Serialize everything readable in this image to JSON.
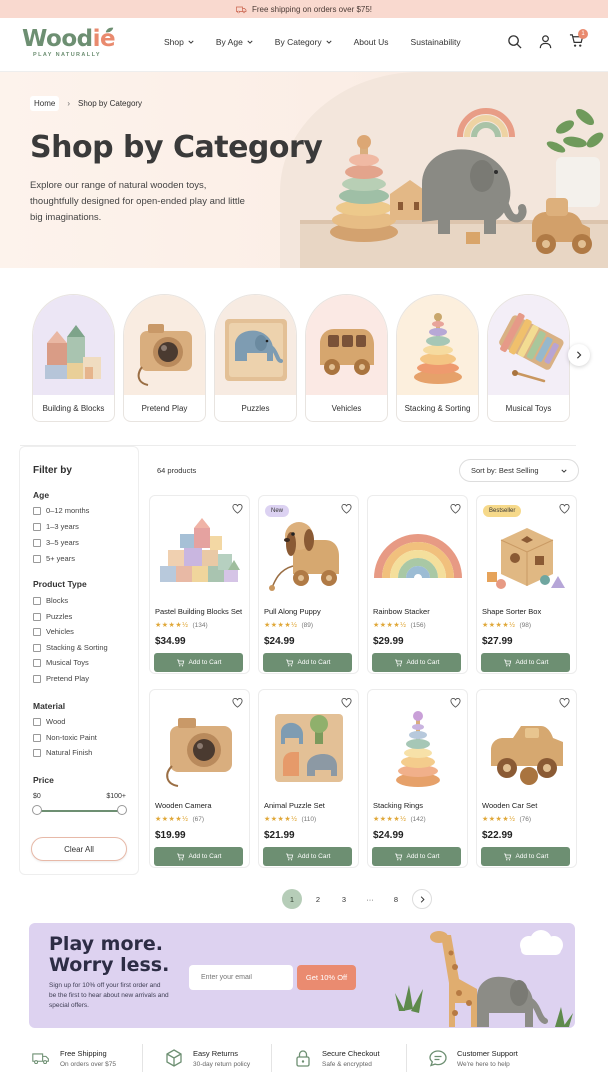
{
  "promo": {
    "text": "Free shipping on orders over $75!"
  },
  "brand": {
    "name_part1": "Wood",
    "name_part2": "ie",
    "tagline": "PLAY NATURALLY"
  },
  "nav": [
    {
      "label": "Shop",
      "has_dropdown": true
    },
    {
      "label": "By Age",
      "has_dropdown": true
    },
    {
      "label": "By Category",
      "has_dropdown": true
    },
    {
      "label": "About Us",
      "has_dropdown": false
    },
    {
      "label": "Sustainability",
      "has_dropdown": false
    }
  ],
  "header_icons": [
    "search-icon",
    "user-icon",
    "cart-icon"
  ],
  "cart_count": "1",
  "breadcrumb": {
    "home": "Home",
    "current": "Shop by Category"
  },
  "hero": {
    "title": "Shop by Category",
    "subtitle": "Explore our range of natural wooden toys, thoughtfully designed for open-ended play and little big imaginations."
  },
  "categories": [
    {
      "label": "Building & Blocks",
      "icon": "blocks",
      "bg": "#ece6f5"
    },
    {
      "label": "Pretend Play",
      "icon": "camera",
      "bg": "#f9ece1"
    },
    {
      "label": "Puzzles",
      "icon": "elephant-puzzle",
      "bg": "#f7ebe2"
    },
    {
      "label": "Vehicles",
      "icon": "bus",
      "bg": "#fbe9e4"
    },
    {
      "label": "Stacking & Sorting",
      "icon": "stacker",
      "bg": "#fcefdd"
    },
    {
      "label": "Musical Toys",
      "icon": "xylophone",
      "bg": "#f3eef7"
    }
  ],
  "filter": {
    "title": "Filter by",
    "groups": [
      {
        "title": "Age",
        "options": [
          "0–12 months",
          "1–3 years",
          "3–5 years",
          "5+ years"
        ]
      },
      {
        "title": "Product Type",
        "options": [
          "Blocks",
          "Puzzles",
          "Vehicles",
          "Stacking & Sorting",
          "Musical Toys",
          "Pretend Play"
        ]
      },
      {
        "title": "Material",
        "options": [
          "Wood",
          "Non-toxic Paint",
          "Natural Finish"
        ]
      }
    ],
    "price": {
      "title": "Price",
      "min_label": "$0",
      "max_label": "$100+",
      "min_fraction": 0.0,
      "max_fraction": 1.0
    },
    "clear_label": "Clear All"
  },
  "results": {
    "count": "64 products",
    "sort_label": "Sort by: Best Selling"
  },
  "products": [
    {
      "name": "Pastel Building Blocks Set",
      "reviews": "(134)",
      "price": "$34.99",
      "rating": 4.5,
      "badge": "",
      "image": "blocks-set"
    },
    {
      "name": "Pull Along Puppy",
      "reviews": "(89)",
      "price": "$24.99",
      "rating": 4.5,
      "badge": "New",
      "image": "puppy"
    },
    {
      "name": "Rainbow Stacker",
      "reviews": "(156)",
      "price": "$29.99",
      "rating": 4.5,
      "badge": "",
      "image": "rainbow"
    },
    {
      "name": "Shape Sorter Box",
      "reviews": "(98)",
      "price": "$27.99",
      "rating": 4.5,
      "badge": "Bestseller",
      "image": "sorter"
    },
    {
      "name": "Wooden Camera",
      "reviews": "(67)",
      "price": "$19.99",
      "rating": 4.5,
      "badge": "",
      "image": "camera"
    },
    {
      "name": "Animal Puzzle Set",
      "reviews": "(110)",
      "price": "$21.99",
      "rating": 4.5,
      "badge": "",
      "image": "animal-puzzle"
    },
    {
      "name": "Stacking Rings",
      "reviews": "(142)",
      "price": "$24.99",
      "rating": 4.5,
      "badge": "",
      "image": "rings"
    },
    {
      "name": "Wooden Car Set",
      "reviews": "(76)",
      "price": "$22.99",
      "rating": 4.5,
      "badge": "",
      "image": "car"
    }
  ],
  "add_to_cart_label": "Add to Cart",
  "pagination": {
    "pages": [
      "1",
      "2",
      "3",
      "···",
      "8"
    ],
    "active": "1"
  },
  "newsletter": {
    "title_line1": "Play more.",
    "title_line2": "Worry less.",
    "subtitle": "Sign up for 10% off your first order and be the first to hear about new arrivals and special offers.",
    "placeholder": "Enter your email",
    "button": "Get 10% Off"
  },
  "features": [
    {
      "title": "Free Shipping",
      "sub": "On orders over $75",
      "icon": "truck-icon"
    },
    {
      "title": "Easy Returns",
      "sub": "30-day return policy",
      "icon": "box-icon"
    },
    {
      "title": "Secure Checkout",
      "sub": "Safe & encrypted",
      "icon": "lock-icon"
    },
    {
      "title": "Customer Support",
      "sub": "We're here to help",
      "icon": "chat-icon"
    }
  ],
  "colors": {
    "accent_green": "#6d8f72",
    "accent_coral": "#e98a6e",
    "promo_bg": "#f9d9cf",
    "newsletter_bg": "#ddd2f0"
  }
}
